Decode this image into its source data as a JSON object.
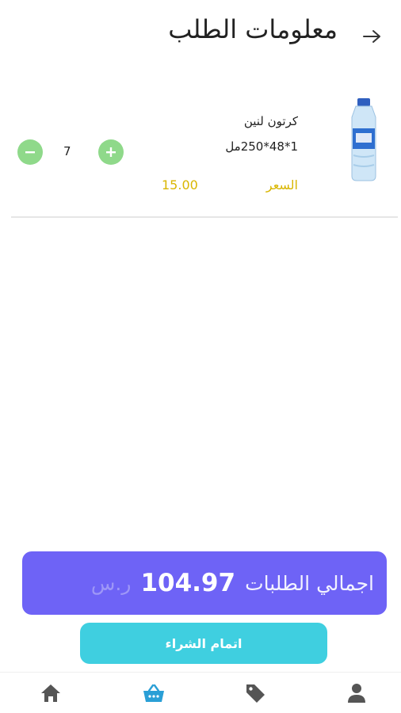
{
  "header": {
    "title": "معلومات الطلب",
    "back_icon": "arrow-right-icon"
  },
  "order_item": {
    "name": "كرتون لنين",
    "size": "1*48*250مل",
    "price_label": "السعر",
    "price_value": "15.00",
    "quantity": "7",
    "image_icon": "water-bottle-icon",
    "minus_icon": "minus-circle-icon",
    "plus_icon": "plus-circle-icon"
  },
  "summary": {
    "total_label": "اجمالي الطلبات",
    "total_amount": "104.97",
    "currency": "ر.س"
  },
  "checkout": {
    "label": "اتمام الشراء"
  },
  "bottom_nav": {
    "items": [
      {
        "icon": "home-icon",
        "active": false
      },
      {
        "icon": "basket-icon",
        "active": true
      },
      {
        "icon": "tag-icon",
        "active": false
      },
      {
        "icon": "user-icon",
        "active": false
      }
    ]
  },
  "colors": {
    "accent_purple": "#6e63f6",
    "checkout_cyan": "#3fcfe0",
    "price_yellow": "#d9b600",
    "qty_green": "#8fd98a",
    "nav_active": "#2a9fd6",
    "nav_inactive": "#555555"
  }
}
